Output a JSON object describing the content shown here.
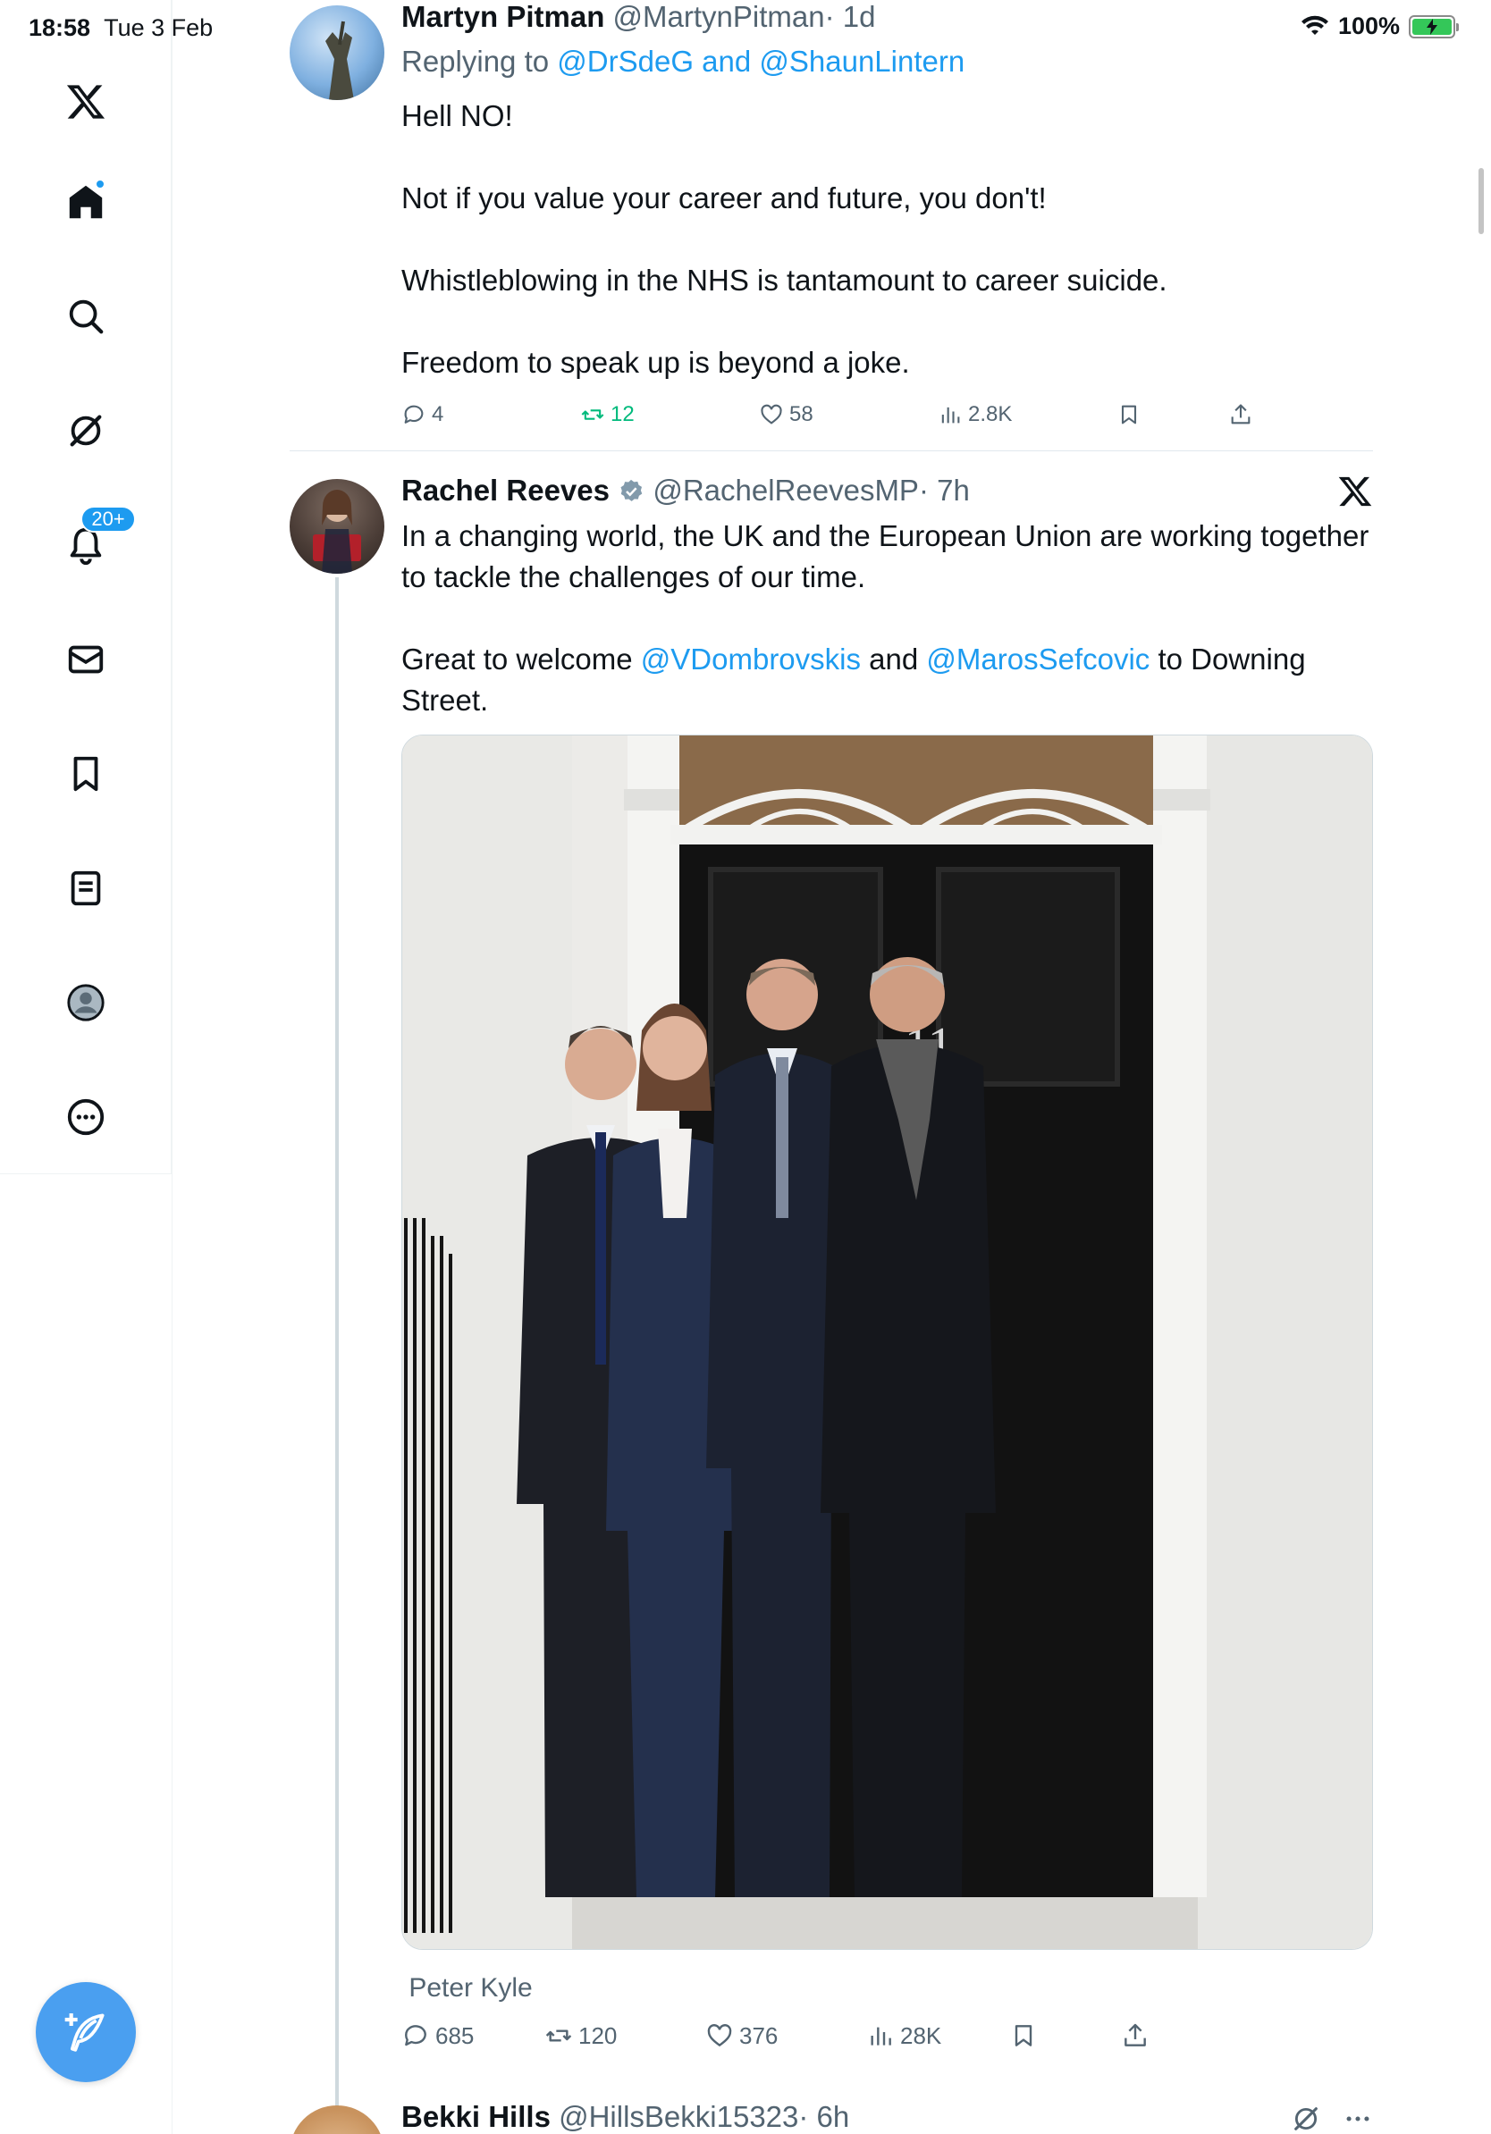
{
  "status_bar": {
    "time": "18:58",
    "date": "Tue 3 Feb",
    "battery": "100%"
  },
  "sidebar": {
    "items": [
      "x-logo",
      "home",
      "search",
      "grok",
      "notifications",
      "messages",
      "bookmarks",
      "lists",
      "profile",
      "more"
    ],
    "notifications_badge": "20+"
  },
  "tweets": [
    {
      "name": "Martyn Pitman",
      "handle": "@MartynPitman",
      "time": "· 1d",
      "replying_prefix": "Replying to",
      "replying_to": "@DrSdeG and @ShaunLintern",
      "paragraphs": [
        "Hell NO!",
        "Not if you value your career and future, you don't!",
        "Whistleblowing in the NHS is tantamount to career suicide.",
        "Freedom to speak up is beyond a joke."
      ],
      "replies": "4",
      "reposts": "12",
      "likes": "58",
      "views": "2.8K"
    },
    {
      "name": "Rachel Reeves",
      "handle": "@RachelReevesMP",
      "time": "· 7h",
      "paragraph1": "In a changing world, the UK and the European Union are working together to tackle the challenges of our time.",
      "p2_prefix": "Great to welcome ",
      "p2_mention1": "@VDombrovskis",
      "p2_mid": " and ",
      "p2_mention2": "@MarosSefcovic",
      "p2_suffix": " to Downing Street.",
      "photo_tag": "Peter Kyle",
      "door_number": "11",
      "replies": "685",
      "reposts": "120",
      "likes": "376",
      "views": "28K"
    },
    {
      "name": "Bekki Hills",
      "handle": "@HillsBekki15323",
      "time": "· 6h"
    }
  ],
  "colors": {
    "accent": "#1d9bf0",
    "repost_active": "#00ba7c",
    "secondary_text": "#536471"
  }
}
